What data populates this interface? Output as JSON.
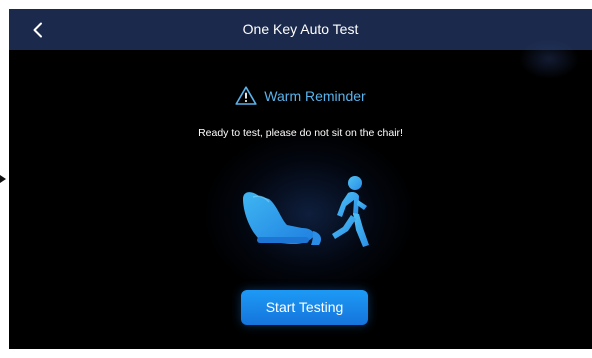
{
  "header": {
    "title": "One Key Auto Test",
    "back_icon": "chevron-left-icon"
  },
  "reminder": {
    "title": "Warm Reminder",
    "icon": "warning-triangle-icon",
    "message": "Ready to test, please do not sit on the chair!"
  },
  "illustration": {
    "icons": [
      "massage-chair-icon",
      "walking-person-icon"
    ]
  },
  "actions": {
    "start_label": "Start Testing"
  },
  "colors": {
    "header_background": "#1b2a4c",
    "screen_background": "#000000",
    "accent": "#5ab3ea",
    "button": "#1a88ee"
  }
}
